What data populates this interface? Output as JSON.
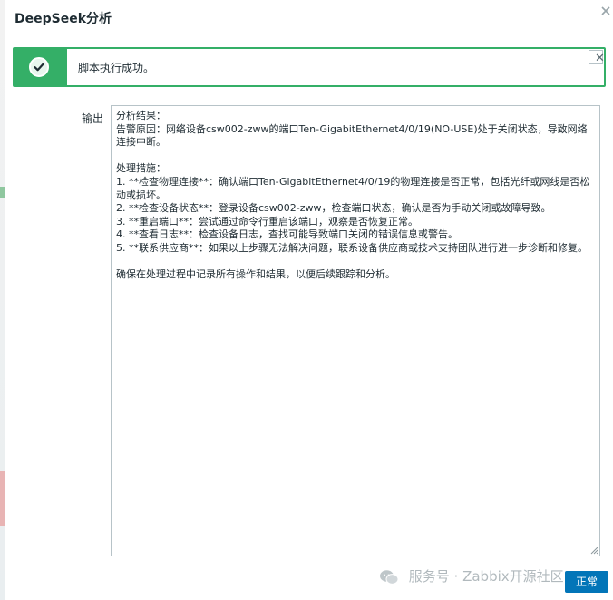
{
  "dialog": {
    "title": "DeepSeek分析",
    "close_icon": "close-icon"
  },
  "message": {
    "status": "success",
    "icon": "check-circle-icon",
    "text": "脚本执行成功。",
    "close_label": "✕",
    "colors": {
      "border": "#34af67",
      "icon_background": "#34af67"
    }
  },
  "form": {
    "output_label": "输出",
    "output_value": "分析结果：\n告警原因：网络设备csw002-zww的端口Ten-GigabitEthernet4/0/19(NO-USE)处于关闭状态，导致网络连接中断。\n\n处理措施：\n1. **检查物理连接**：确认端口Ten-GigabitEthernet4/0/19的物理连接是否正常，包括光纤或网线是否松动或损坏。\n2. **检查设备状态**：登录设备csw002-zww，检查端口状态，确认是否为手动关闭或故障导致。\n3. **重启端口**：尝试通过命令行重启该端口，观察是否恢复正常。\n4. **查看日志**：检查设备日志，查找可能导致端口关闭的错误信息或警告。\n5. **联系供应商**：如果以上步骤无法解决问题，联系设备供应商或技术支持团队进行进一步诊断和修复。\n\n确保在处理过程中记录所有操作和结果，以便后续跟踪和分析。"
  },
  "watermark": {
    "icon": "wechat-icon",
    "text": "服务号 · Zabbix开源社区"
  },
  "footer": {
    "confirm_label": "正常",
    "confirm_color": "#0275b8"
  }
}
